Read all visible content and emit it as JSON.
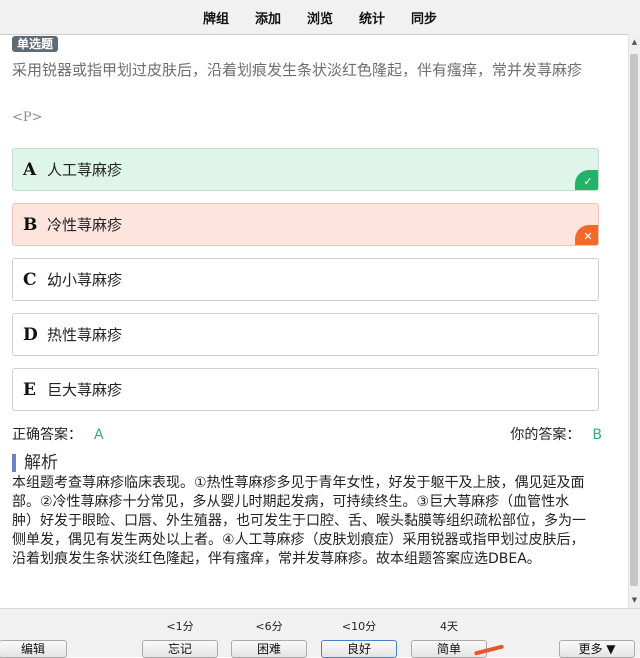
{
  "topbar": {
    "tabs": [
      "牌组",
      "添加",
      "浏览",
      "统计",
      "同步"
    ]
  },
  "card": {
    "type_badge": "单选题",
    "question": "采用锐器或指甲划过皮肤后，沿着划痕发生条状淡红色隆起，伴有瘙痒，常并发荨麻疹",
    "p_tag": "<P>",
    "options": [
      {
        "letter": "A",
        "text": "人工荨麻疹",
        "state": "correct"
      },
      {
        "letter": "B",
        "text": "冷性荨麻疹",
        "state": "wrong"
      },
      {
        "letter": "C",
        "text": "幼小荨麻疹",
        "state": "normal"
      },
      {
        "letter": "D",
        "text": "热性荨麻疹",
        "state": "normal"
      },
      {
        "letter": "E",
        "text": "巨大荨麻疹",
        "state": "normal"
      }
    ],
    "correct_label": "正确答案：",
    "correct_value": "A",
    "your_label": "你的答案：",
    "your_value": "B",
    "analysis_title": "解析",
    "analysis_text": "本组题考查荨麻疹临床表现。①热性荨麻疹多见于青年女性，好发于躯干及上肢，偶见延及面部。②冷性荨麻疹十分常见，多从婴儿时期起发病，可持续终生。③巨大荨麻疹（血管性水肿）好发于眼睑、口唇、外生殖器，也可发生于口腔、舌、喉头黏膜等组织疏松部位，多为一侧单发，偶见有发生两处以上者。④人工荨麻疹（皮肤划痕症）采用锐器或指甲划过皮肤后，沿着划痕发生条状淡红色隆起，伴有瘙痒，常并发荨麻疹。故本组题答案应选DBEA。"
  },
  "bottombar": {
    "edit": "编辑",
    "more": "更多 ▼",
    "ratings": [
      {
        "time": "<1分",
        "label": "忘记"
      },
      {
        "time": "<6分",
        "label": "困难"
      },
      {
        "time": "<10分",
        "label": "良好"
      },
      {
        "time": "4天",
        "label": "简单"
      }
    ]
  },
  "colors": {
    "correct_bg": "#dff5e9",
    "wrong_bg": "#fde5dd",
    "correct_mark": "#22b26a",
    "wrong_mark": "#f26a2b",
    "answer_text": "#2bb673",
    "analysis_bar": "#6b82c9"
  },
  "icons": {
    "correct": "check-icon",
    "wrong": "cross-icon"
  }
}
